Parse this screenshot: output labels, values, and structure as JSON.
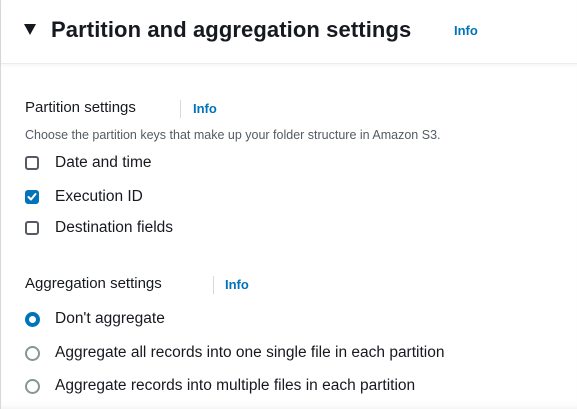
{
  "section": {
    "title": "Partition and aggregation settings",
    "info": "Info"
  },
  "partition": {
    "label": "Partition settings",
    "info": "Info",
    "description": "Choose the partition keys that make up your folder structure in Amazon S3.",
    "options": [
      {
        "label": "Date and time",
        "checked": false
      },
      {
        "label": "Execution ID",
        "checked": true
      },
      {
        "label": "Destination fields",
        "checked": false
      }
    ]
  },
  "aggregation": {
    "label": "Aggregation settings",
    "info": "Info",
    "options": [
      {
        "label": "Don't aggregate",
        "selected": true
      },
      {
        "label": "Aggregate all records into one single file in each partition",
        "selected": false
      },
      {
        "label": "Aggregate records into multiple files in each partition",
        "selected": false
      }
    ]
  },
  "colors": {
    "accent": "#0073bb",
    "text": "#16191f",
    "secondary_text": "#545b64"
  }
}
